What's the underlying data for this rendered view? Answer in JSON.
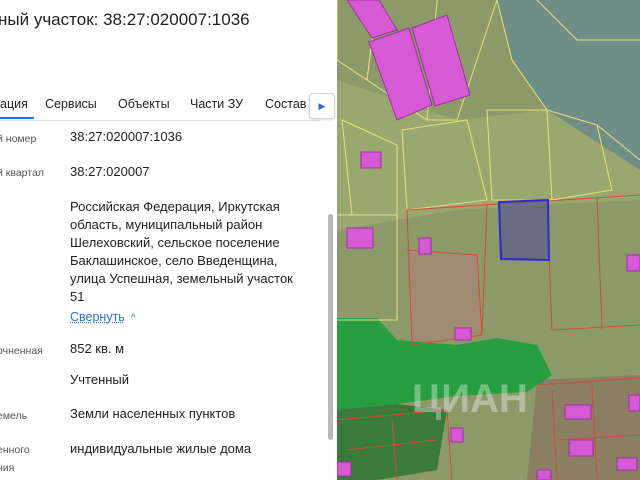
{
  "header": {
    "title": "ный участок: 38:27:020007:1036"
  },
  "tabs": [
    {
      "label": "ация"
    },
    {
      "label": "Сервисы"
    },
    {
      "label": "Объекты"
    },
    {
      "label": "Части ЗУ"
    },
    {
      "label": "Состав"
    }
  ],
  "tabs_next_icon": "chevron-right-icon",
  "details": {
    "cad_number_label": "й номер",
    "cad_number_value": "38:27:020007:1036",
    "quarter_label": "й квартал",
    "quarter_value": "38:27:020007",
    "address_lines": [
      "Российская Федерация, Иркутская",
      "область, муниципальный район",
      "Шелеховский, сельское поселение",
      "Баклашинское, село Введенщина,",
      "улица Успешная, земельный участок",
      "51"
    ],
    "collapse_label": "Свернуть",
    "area_label": "очненная",
    "area_value": "852 кв. м",
    "status_value": "Учтенный",
    "category_label": "емель",
    "category_value": "Земли населенных пунктов",
    "use_label_1": "енного",
    "use_label_2": "ния",
    "use_value": "индивидуальные жилые дома"
  },
  "map": {
    "watermark": "ЦИАН"
  },
  "colors": {
    "accent": "#2b6fd6",
    "building": "#d65ad6",
    "parcel_line": "#e8e07a",
    "selected_parcel": "#2a2ad8"
  }
}
